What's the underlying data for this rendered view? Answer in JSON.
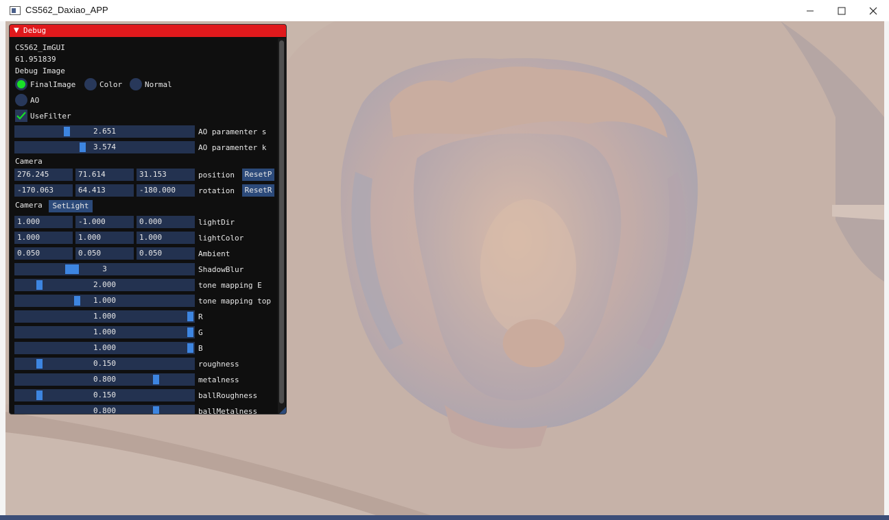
{
  "window": {
    "title": "CS562_Daxiao_APP"
  },
  "debug": {
    "header": "Debug",
    "app_name": "CS562_ImGUI",
    "fps": "61.951839",
    "debug_image_label": "Debug Image",
    "radios": [
      {
        "label": "FinalImage",
        "selected": true
      },
      {
        "label": "Color",
        "selected": false
      },
      {
        "label": "Normal",
        "selected": false
      },
      {
        "label": "AO",
        "selected": false
      }
    ],
    "use_filter": {
      "label": "UseFilter",
      "checked": true
    },
    "ao_s": {
      "label": "AO paramenter s",
      "value": "2.651",
      "fraction": 0.28
    },
    "ao_k": {
      "label": "AO paramenter k",
      "value": "3.574",
      "fraction": 0.37
    },
    "camera_label": "Camera",
    "position": {
      "label": "position",
      "values": [
        "276.245",
        "71.614",
        "31.153"
      ],
      "button": "ResetP"
    },
    "rotation": {
      "label": "rotation",
      "values": [
        "-170.063",
        "64.413",
        "-180.000"
      ],
      "button": "ResetR"
    },
    "camera_label2": "Camera",
    "set_light": "SetLight",
    "light_dir": {
      "label": "lightDir",
      "values": [
        "1.000",
        "-1.000",
        "0.000"
      ]
    },
    "light_color": {
      "label": "lightColor",
      "values": [
        "1.000",
        "1.000",
        "1.000"
      ]
    },
    "ambient": {
      "label": "Ambient",
      "values": [
        "0.050",
        "0.050",
        "0.050"
      ]
    },
    "sliders": [
      {
        "label": "ShadowBlur",
        "value": "3",
        "fraction": 0.3
      },
      {
        "label": "tone mapping E",
        "value": "2.000",
        "fraction": 0.12
      },
      {
        "label": "tone mapping top",
        "value": "1.000",
        "fraction": 0.34
      },
      {
        "label": "R",
        "value": "1.000",
        "fraction": 1.0
      },
      {
        "label": "G",
        "value": "1.000",
        "fraction": 1.0
      },
      {
        "label": "B",
        "value": "1.000",
        "fraction": 1.0
      },
      {
        "label": "roughness",
        "value": "0.150",
        "fraction": 0.12
      },
      {
        "label": "metalness",
        "value": "0.800",
        "fraction": 0.8
      },
      {
        "label": "ballRoughness",
        "value": "0.150",
        "fraction": 0.12
      },
      {
        "label": "ballMetalness",
        "value": "0.800",
        "fraction": 0.8
      }
    ]
  },
  "colors": {
    "header": "#e0191c",
    "frame": "#233250",
    "grab": "#3d85e0",
    "radio_on": "#19e028",
    "check": "#19e028"
  }
}
